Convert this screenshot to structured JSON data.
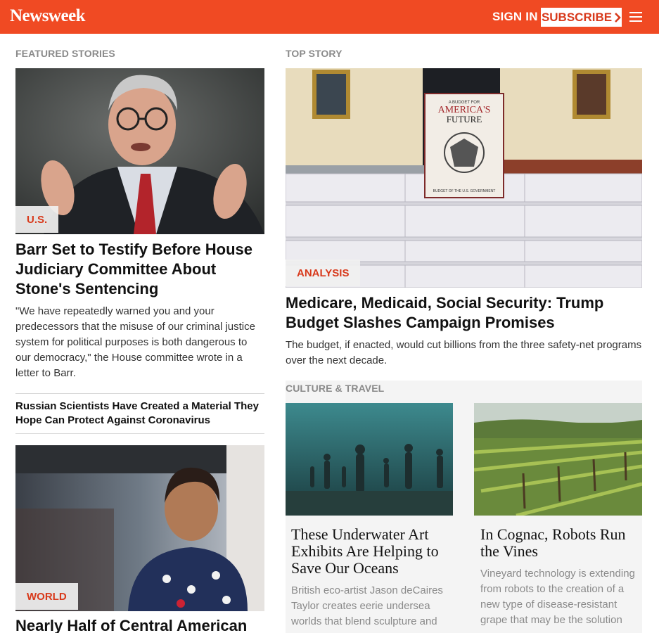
{
  "header": {
    "logo": "Newsweek",
    "sign_in": "SIGN IN",
    "subscribe": "SUBSCRIBE",
    "subscribe_icon": "chevron-right-icon",
    "menu_icon": "hamburger-menu-icon",
    "brand_color": "#f04a23"
  },
  "featured": {
    "label": "FEATURED STORIES",
    "lead": {
      "tag": "U.S.",
      "headline": "Barr Set to Testify Before House Judiciary Committee About Stone's Sentencing",
      "dek": "\"We have repeatedly warned you and your predecessors that the misuse of our criminal justice system for political purposes is both dangerous to our democracy,\" the House committee wrote in a letter to Barr."
    },
    "secondary": {
      "headline": "Russian Scientists Have Created a Material They Hope Can Protect Against Coronavirus"
    },
    "third": {
      "tag": "WORLD",
      "headline": "Nearly Half of Central American"
    }
  },
  "top_story": {
    "label": "TOP STORY",
    "tag": "ANALYSIS",
    "headline": "Medicare, Medicaid, Social Security: Trump Budget Slashes Campaign Promises",
    "dek": "The budget, if enacted, would cut billions from the three safety-net programs over the next decade.",
    "book_title_top": "A BUDGET FOR",
    "book_title_main": "AMERICA'S",
    "book_title_sub": "FUTURE",
    "book_footer": "BUDGET OF THE U.S. GOVERNMENT"
  },
  "culture": {
    "label": "CULTURE & TRAVEL",
    "items": [
      {
        "headline": "These Underwater Art Exhibits Are Helping to Save Our Oceans",
        "dek": "British eco-artist Jason deCaires Taylor creates eerie undersea worlds that blend sculpture and"
      },
      {
        "headline": "In Cognac, Robots Run the Vines",
        "dek": "Vineyard technology is extending from robots to the creation of a new type of disease-resistant grape that may be the solution"
      }
    ]
  }
}
